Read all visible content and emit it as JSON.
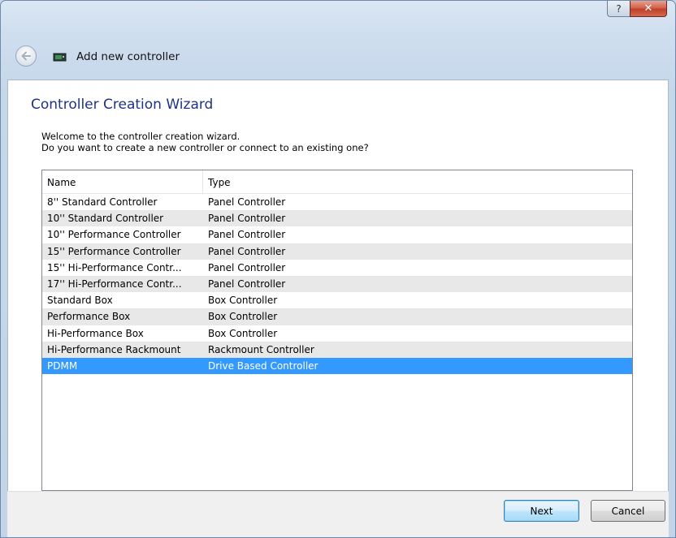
{
  "window": {
    "help_glyph": "?",
    "close_glyph": "✕",
    "title": "Add new controller"
  },
  "wizard": {
    "title": "Controller Creation Wizard",
    "intro_line1": "Welcome to the controller creation wizard.",
    "intro_line2": "Do you want to create a new controller or connect to an existing one?"
  },
  "list": {
    "columns": [
      "Name",
      "Type"
    ],
    "rows": [
      {
        "name": "8'' Standard Controller",
        "type": "Panel Controller"
      },
      {
        "name": "10'' Standard Controller",
        "type": "Panel Controller"
      },
      {
        "name": "10'' Performance Controller",
        "type": "Panel Controller"
      },
      {
        "name": "15'' Performance Controller",
        "type": "Panel Controller"
      },
      {
        "name": "15'' Hi-Performance Contr...",
        "type": "Panel Controller"
      },
      {
        "name": "17'' Hi-Performance Contr...",
        "type": "Panel Controller"
      },
      {
        "name": "Standard Box",
        "type": "Box Controller"
      },
      {
        "name": "Performance Box",
        "type": "Box Controller"
      },
      {
        "name": "Hi-Performance Box",
        "type": "Box Controller"
      },
      {
        "name": "Hi-Performance Rackmount",
        "type": "Rackmount Controller"
      },
      {
        "name": "PDMM",
        "type": "Drive Based Controller"
      }
    ],
    "selected_index": 10
  },
  "buttons": {
    "next": "Next",
    "cancel": "Cancel"
  },
  "icons": {
    "back": "back-arrow-icon",
    "app": "controller-device-icon",
    "help": "help-icon",
    "close": "close-icon"
  },
  "colors": {
    "title_blue": "#1e3287",
    "selection": "#3399ff"
  }
}
